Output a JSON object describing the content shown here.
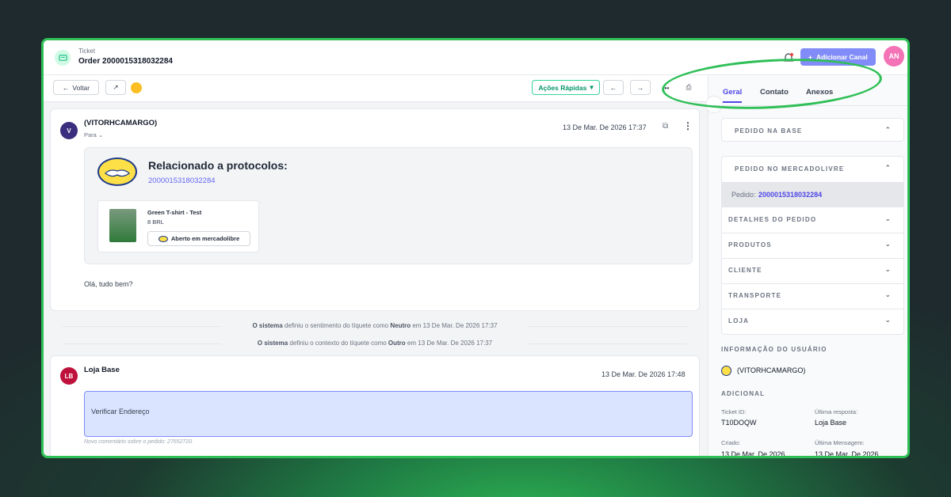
{
  "header": {
    "kind": "Ticket",
    "title": "Order 2000015318032284",
    "add_channel": "Adicionar Canal",
    "avatar": "AN"
  },
  "toolbar": {
    "back": "Voltar",
    "quick_actions": "Ações Rápidas"
  },
  "message1": {
    "avatar": "V",
    "sender": "(VITORHCAMARGO)",
    "to": "Para",
    "datetime": "13 De Mar. De 2026 17:37",
    "related_title": "Relacionado a protocolos:",
    "related_link": "2000015318032284",
    "product": {
      "name": "Green T-shirt - Test",
      "price": "8 BRL",
      "button": "Aberto em mercadolibre"
    },
    "body": "Olá, tudo bem?"
  },
  "system_events": [
    {
      "actor": "O sistema",
      "text1": " definiu o sentimento do tíquete como ",
      "value": "Neutro",
      "text2": " em 13 De Mar. De 2026 17:37"
    },
    {
      "actor": "O sistema",
      "text1": " definiu o contexto do tíquete como ",
      "value": "Outro",
      "text2": " em 13 De Mar. De 2026 17:37"
    }
  ],
  "message2": {
    "avatar": "LB",
    "sender": "Loja Base",
    "datetime": "13 De Mar. De 2026 17:48",
    "body": "Verificar Endereço",
    "note": "Novo comentário sobre o pedido: 27652720"
  },
  "right_panel": {
    "tabs": [
      "Geral",
      "Contato",
      "Anexos"
    ],
    "pedido_base": "PEDIDO NA BASE",
    "pedido_ml": "PEDIDO NO MERCADOLIVRE",
    "pedido_label": "Pedido:",
    "pedido_value": "2000015318032284",
    "sections": [
      "DETALHES DO PEDIDO",
      "PRODUTOS",
      "CLIENTE",
      "TRANSPORTE",
      "LOJA"
    ],
    "user_info_title": "INFORMAÇÃO DO USUÁRIO",
    "user_name": "(VITORHCAMARGO)",
    "additional_title": "ADICIONAL",
    "ticket_id_label": "Ticket ID:",
    "ticket_id": "T10DOQW",
    "last_reply_label": "Última resposta:",
    "last_reply": "Loja Base",
    "created_label": "Criado:",
    "created": "13 De Mar. De 2026",
    "last_message_label": "Última Mensagem:",
    "last_message": "13 De Mar. De 2026"
  },
  "colors": {
    "accent": "#4f46e5",
    "green_frame": "#2fbf57",
    "add_button": "#818cf8"
  }
}
